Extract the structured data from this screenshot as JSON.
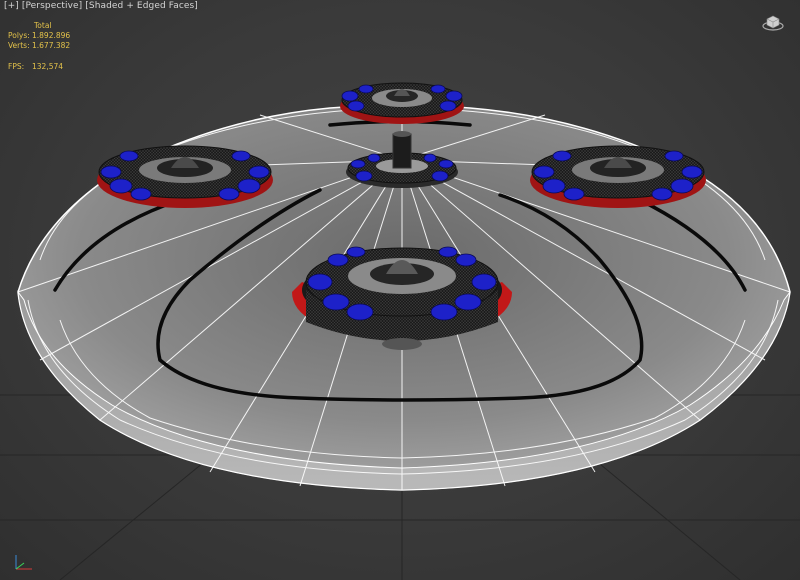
{
  "viewport": {
    "menu_label": "[+]",
    "view_label": "[Perspective]",
    "shading_label": "[Shaded + Edged Faces]"
  },
  "stats": {
    "header": "Total",
    "polys_label": "Polys:",
    "polys_value": "1.892.896",
    "verts_label": "Verts:",
    "verts_value": "1.677.382",
    "fps_label": "FPS:",
    "fps_value": "132,574"
  },
  "icons": {
    "viewcube": "home-viewcube-icon",
    "axis": "axis-tripod-icon"
  },
  "colors": {
    "background": "#3a3a3a",
    "stats_text": "#e3c24a",
    "wire": "#ffffff",
    "module_dark": "#222222",
    "bolt_blue": "#1d21c9",
    "ring_red": "#c21818"
  }
}
